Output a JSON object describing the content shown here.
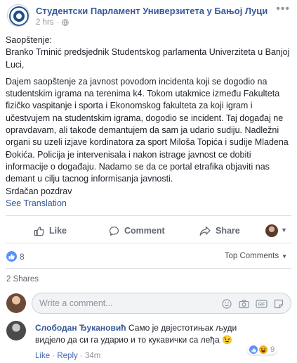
{
  "post": {
    "page_name": "Студентски Парламент Универзитета у Бањој Луци",
    "time": "2 hrs",
    "visibility_icon": "globe-icon",
    "more_icon": "more-icon",
    "body": {
      "p1": "Saopštenje:\nBranko Trninić predsjednik Studentskog parlamenta Univerziteta u Banjoj Luci,",
      "p2": "Dajem saopštenje za javnost povodom incidenta koji se dogodio na studentskim igrama na terenima k4. Tokom utakmice između Fakulteta fizičko vaspitanje i sporta i Ekonomskog fakulteta za koji igram i učestvujem na studentskim igrama, dogodio se incident. Taj događaj ne opravdavam, ali takođe demantujem da sam ja udario sudiju. Nadležni organi su uzeli izjave kordinatora za sport Miloša Topića i sudije Mladena Đokića. Policija je intervenisala i nakon istrage javnost ce dobiti informacije o događaju. Nadamo se da ce portal etrafika objaviti nas demant u cilju tacnog informisanja javnosti.\nSrdačan pozdrav"
    },
    "see_translation": "See Translation"
  },
  "actions": {
    "like": "Like",
    "comment": "Comment",
    "share": "Share"
  },
  "reactions": {
    "count": "8",
    "sort_label": "Top Comments",
    "shares": "2 Shares"
  },
  "comment_box": {
    "placeholder": "Write a comment..."
  },
  "comment": {
    "author": "Слободан Ђукановић",
    "text": " Само је двјестотињак људи видјело да си га ударио и то кукавички са леђа 😉",
    "reaction_count": "9",
    "like_label": "Like",
    "reply_label": "Reply",
    "time": "34m",
    "separator": " · "
  },
  "colors": {
    "link": "#365899",
    "like_blue": "#5890ff",
    "muted": "#90949c"
  }
}
